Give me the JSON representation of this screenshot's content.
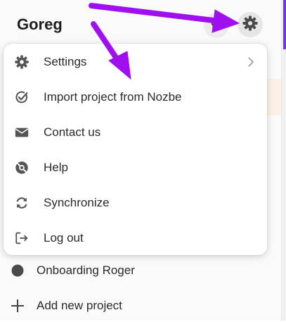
{
  "header": {
    "title": "Goreg",
    "search_icon": "search-icon",
    "settings_icon": "gear-icon"
  },
  "menu": {
    "items": [
      {
        "label": "Settings",
        "icon": "gear-icon",
        "has_submenu": true
      },
      {
        "label": "Import project from Nozbe",
        "icon": "check-circle-icon"
      },
      {
        "label": "Contact us",
        "icon": "envelope-icon"
      },
      {
        "label": "Help",
        "icon": "life-ring-icon"
      },
      {
        "label": "Synchronize",
        "icon": "sync-icon"
      },
      {
        "label": "Log out",
        "icon": "logout-icon"
      }
    ]
  },
  "projects": {
    "items": [
      {
        "label": "Onboarding Roger",
        "icon": "dot-icon"
      },
      {
        "label": "Add new project",
        "icon": "plus-icon"
      }
    ]
  },
  "colors": {
    "annotation_arrow": "#a00ff0",
    "icon": "#555555",
    "accent": "#7b2ff7"
  }
}
